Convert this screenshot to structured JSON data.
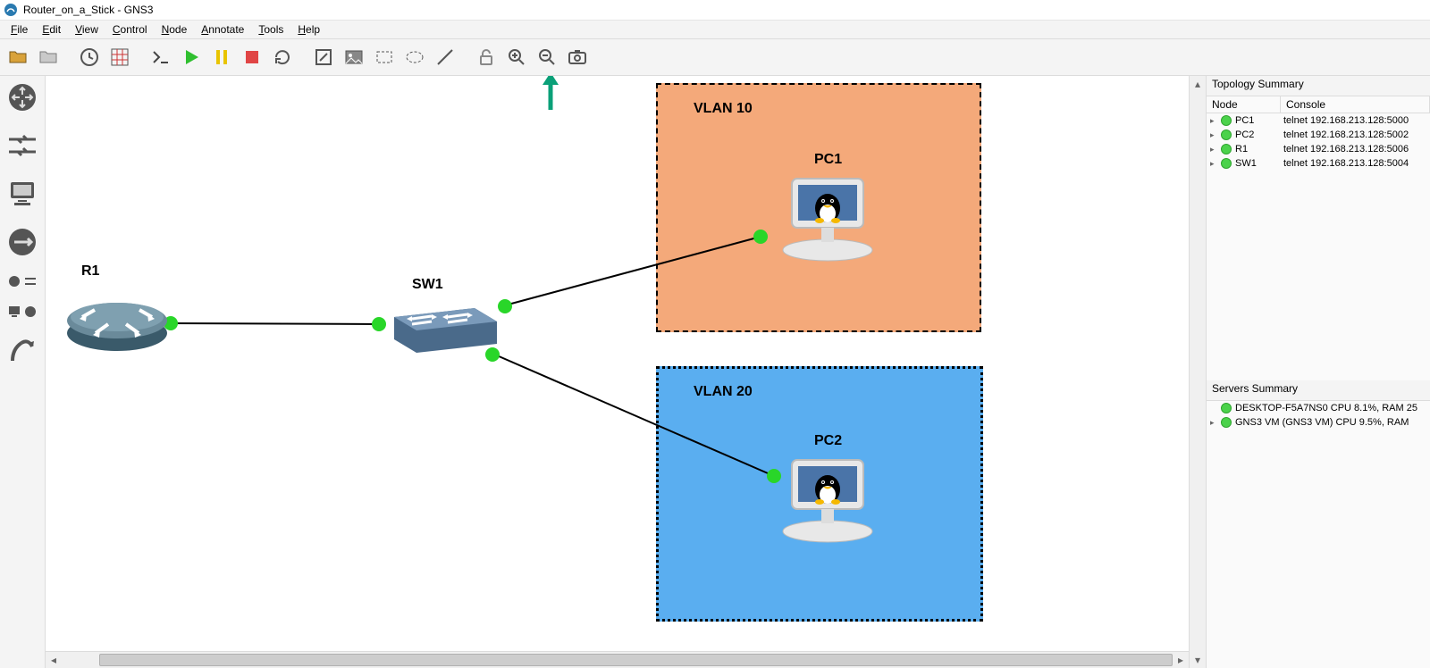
{
  "title": "Router_on_a_Stick - GNS3",
  "menu": [
    "File",
    "Edit",
    "View",
    "Control",
    "Node",
    "Annotate",
    "Tools",
    "Help"
  ],
  "devicedock_icons": [
    "router-category-icon",
    "switch-category-icon",
    "enddevice-category-icon",
    "security-category-icon",
    "alldevices-category-icon",
    "link-tool-icon"
  ],
  "topology": {
    "nodes": {
      "R1": {
        "label": "R1"
      },
      "SW1": {
        "label": "SW1"
      },
      "PC1": {
        "label": "PC1"
      },
      "PC2": {
        "label": "PC2"
      }
    },
    "zones": {
      "vlan10": {
        "label": "VLAN 10"
      },
      "vlan20": {
        "label": "VLAN 20"
      }
    }
  },
  "topologySummary": {
    "title": "Topology Summary",
    "columns": [
      "Node",
      "Console"
    ],
    "rows": [
      {
        "name": "PC1",
        "console": "telnet 192.168.213.128:5000"
      },
      {
        "name": "PC2",
        "console": "telnet 192.168.213.128:5002"
      },
      {
        "name": "R1",
        "console": "telnet 192.168.213.128:5006"
      },
      {
        "name": "SW1",
        "console": "telnet 192.168.213.128:5004"
      }
    ]
  },
  "serversSummary": {
    "title": "Servers Summary",
    "rows": [
      {
        "text": "DESKTOP-F5A7NS0 CPU 8.1%, RAM 25"
      },
      {
        "text": "GNS3 VM (GNS3 VM) CPU 9.5%, RAM"
      }
    ]
  }
}
